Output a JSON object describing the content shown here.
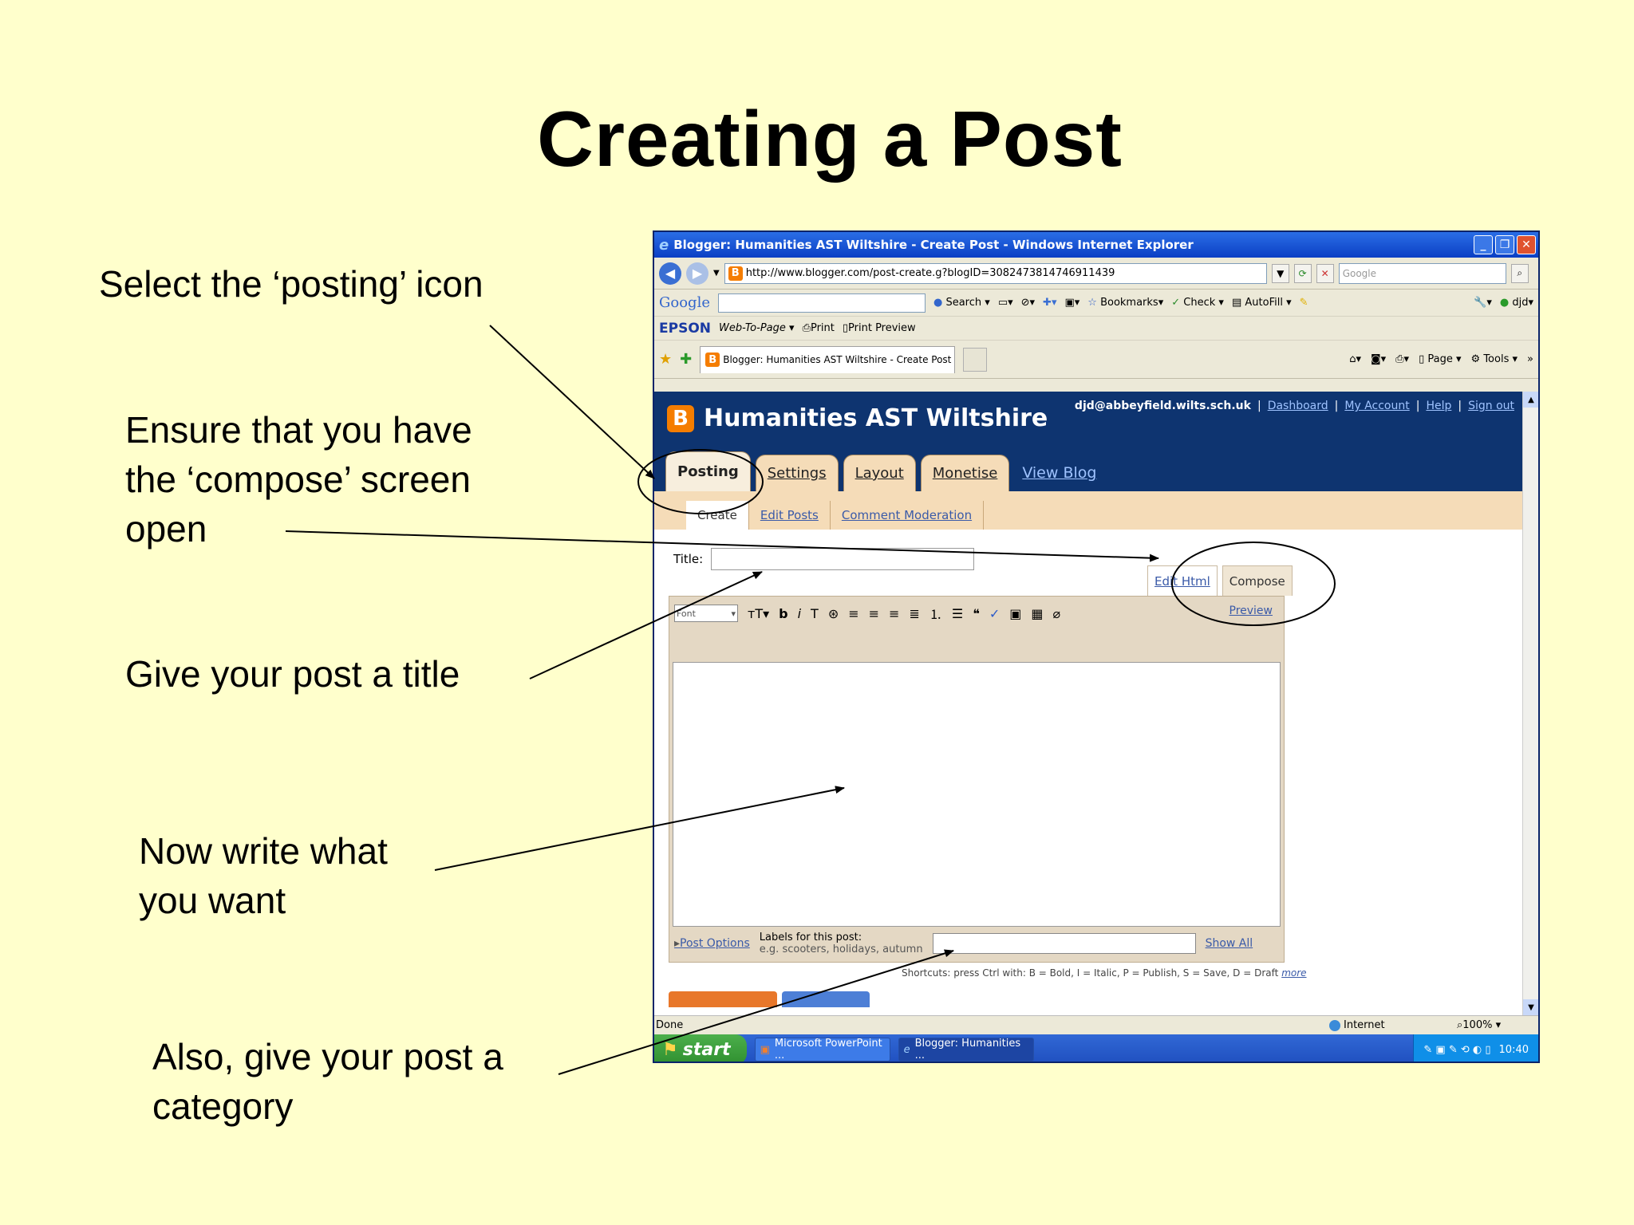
{
  "slide": {
    "title": "Creating a Post",
    "annotations": {
      "select_posting": "Select the ‘posting’ icon",
      "compose_line1": "Ensure that you have",
      "compose_line2": "the ‘compose’ screen",
      "compose_line3": "open",
      "give_title": "Give your post a title",
      "write_line1": "Now write what",
      "write_line2": "you want",
      "category_line1": "Also, give your post a",
      "category_line2": "category"
    }
  },
  "browser": {
    "window_title": "Blogger: Humanities AST Wiltshire - Create Post - Windows Internet Explorer",
    "url": "http://www.blogger.com/post-create.g?blogID=3082473814746911439",
    "search_placeholder": "Google",
    "google_toolbar": {
      "logo": "Google",
      "search": "Search",
      "bookmarks": "Bookmarks",
      "check": "Check",
      "autofill": "AutoFill",
      "user": "djd"
    },
    "epson_toolbar": {
      "logo": "EPSON",
      "web_to_page": "Web-To-Page",
      "print": "Print",
      "print_preview": "Print Preview"
    },
    "tab_title": "Blogger: Humanities AST Wiltshire - Create Post",
    "command_bar": {
      "page": "Page",
      "tools": "Tools"
    },
    "status": {
      "left": "Done",
      "zone": "Internet",
      "zoom": "100%"
    }
  },
  "blogger": {
    "blog_title": "Humanities AST Wiltshire",
    "email": "djd@abbeyfield.wilts.sch.uk",
    "links": [
      "Dashboard",
      "My Account",
      "Help",
      "Sign out"
    ],
    "main_tabs": [
      "Posting",
      "Settings",
      "Layout",
      "Monetise"
    ],
    "view_blog": "View Blog",
    "sub_tabs": [
      "Create",
      "Edit Posts",
      "Comment Moderation"
    ],
    "title_label": "Title:",
    "edit_html": "Edit Html",
    "compose": "Compose",
    "preview": "Preview",
    "font_select": "Font",
    "post_options": "Post Options",
    "labels_title": "Labels for this post:",
    "labels_hint": "e.g. scooters, holidays, autumn",
    "show_all": "Show All",
    "shortcuts": "Shortcuts: press Ctrl with: B = Bold, I = Italic, P = Publish, S = Save, D = Draft",
    "shortcuts_more": "more"
  },
  "taskbar": {
    "start": "start",
    "items": [
      "Microsoft PowerPoint ...",
      "Blogger: Humanities ..."
    ],
    "clock": "10:40"
  },
  "colors": {
    "slide_bg": "#ffffcc",
    "blogger_header": "#0e3470",
    "blogger_tab": "#f5dcb8",
    "xp_blue": "#1f4fbf"
  }
}
